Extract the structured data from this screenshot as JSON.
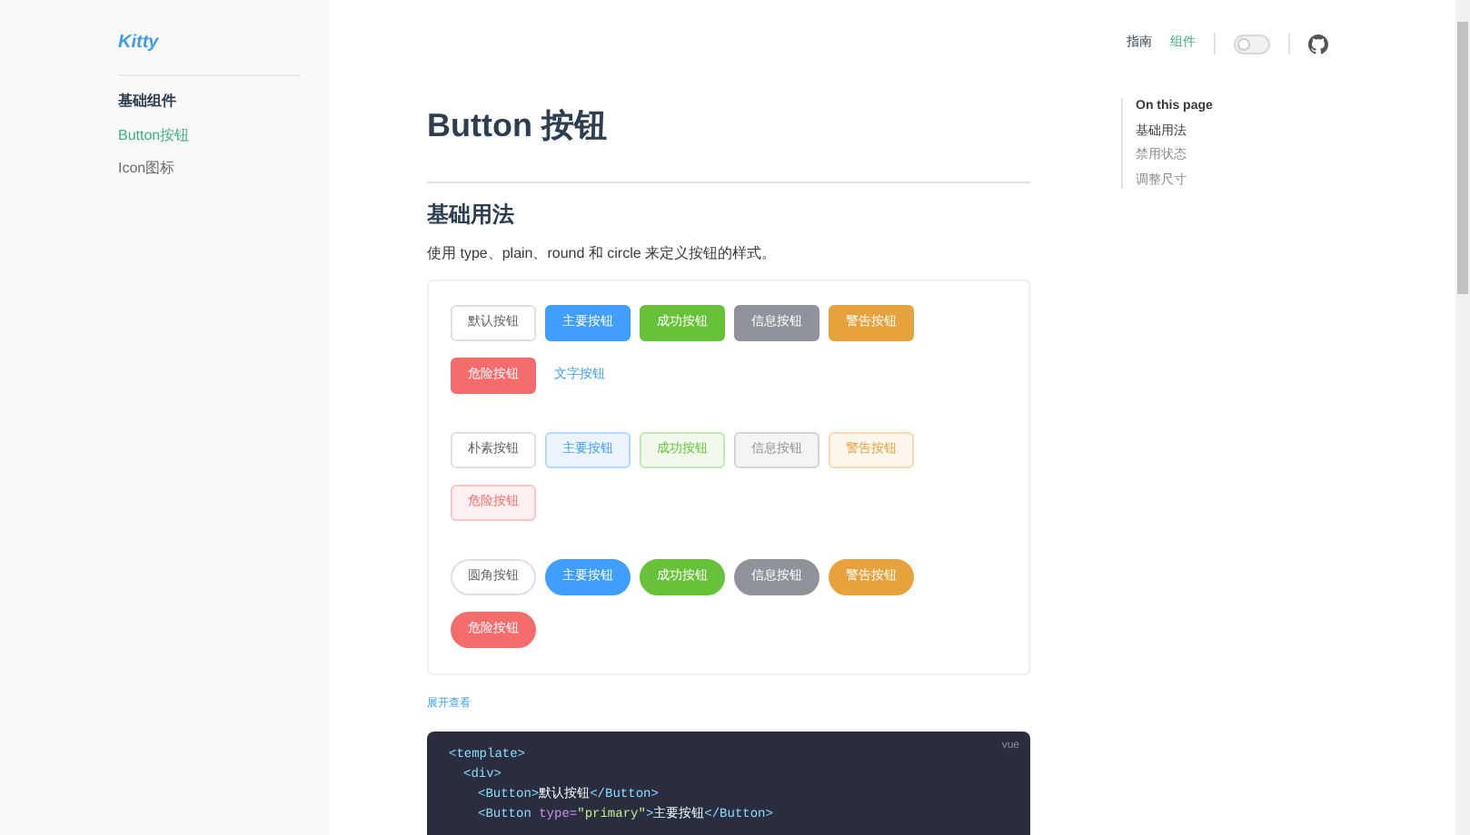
{
  "sidebar": {
    "logo": "Kitty",
    "group_title": "基础组件",
    "items": [
      {
        "label": "Button按钮",
        "selected": true
      },
      {
        "label": "Icon图标",
        "selected": false
      }
    ]
  },
  "nav": {
    "links": [
      {
        "label": "指南",
        "selected": false
      },
      {
        "label": "组件",
        "selected": true
      }
    ],
    "theme_toggle": {
      "on": false
    }
  },
  "page": {
    "title": "Button 按钮",
    "section_title": "基础用法",
    "description": "使用 type、plain、round 和 circle 来定义按钮的样式。",
    "demo_groups": [
      {
        "kind": "default",
        "buttons": [
          {
            "label": "默认按钮",
            "kind": "default"
          },
          {
            "label": "主要按钮",
            "kind": "primary"
          },
          {
            "label": "成功按钮",
            "kind": "success"
          },
          {
            "label": "信息按钮",
            "kind": "info"
          },
          {
            "label": "警告按钮",
            "kind": "warning"
          },
          {
            "label": "危险按钮",
            "kind": "danger"
          },
          {
            "label": "文字按钮",
            "kind": "text"
          }
        ]
      },
      {
        "kind": "plain",
        "buttons": [
          {
            "label": "朴素按钮",
            "kind": "default"
          },
          {
            "label": "主要按钮",
            "kind": "primary"
          },
          {
            "label": "成功按钮",
            "kind": "success"
          },
          {
            "label": "信息按钮",
            "kind": "info"
          },
          {
            "label": "警告按钮",
            "kind": "warning"
          },
          {
            "label": "危险按钮",
            "kind": "danger"
          }
        ]
      },
      {
        "kind": "round",
        "buttons": [
          {
            "label": "圆角按钮",
            "kind": "default"
          },
          {
            "label": "主要按钮",
            "kind": "primary"
          },
          {
            "label": "成功按钮",
            "kind": "success"
          },
          {
            "label": "信息按钮",
            "kind": "info"
          },
          {
            "label": "警告按钮",
            "kind": "warning"
          },
          {
            "label": "危险按钮",
            "kind": "danger"
          }
        ]
      }
    ],
    "expand_link": "展开查看",
    "code": {
      "language": "vue",
      "lines": [
        {
          "segments": [
            {
              "kind": "tag",
              "text": "<template>"
            }
          ],
          "children": [
            {
              "segments": [
                {
                  "kind": "tag",
                  "text": "<div>"
                }
              ],
              "children": [
                {
                  "segments": [
                    {
                      "kind": "tag",
                      "text": "<Button>"
                    },
                    {
                      "kind": "text",
                      "text": "默认按钮"
                    },
                    {
                      "kind": "tag",
                      "text": "</Button>"
                    }
                  ]
                },
                {
                  "segments": [
                    {
                      "kind": "tag",
                      "text": "<Button "
                    },
                    {
                      "kind": "attr",
                      "text": "type="
                    },
                    {
                      "kind": "string",
                      "text": "\"primary\""
                    },
                    {
                      "kind": "tag",
                      "text": ">"
                    },
                    {
                      "kind": "text",
                      "text": "主要按钮"
                    },
                    {
                      "kind": "tag",
                      "text": "</Button>"
                    }
                  ]
                }
              ]
            }
          ]
        }
      ]
    }
  },
  "toc": {
    "title": "On this page",
    "items": [
      {
        "label": "基础用法",
        "selected": true
      },
      {
        "label": "禁用状态",
        "selected": false
      },
      {
        "label": "调整尺寸",
        "selected": false
      }
    ]
  }
}
